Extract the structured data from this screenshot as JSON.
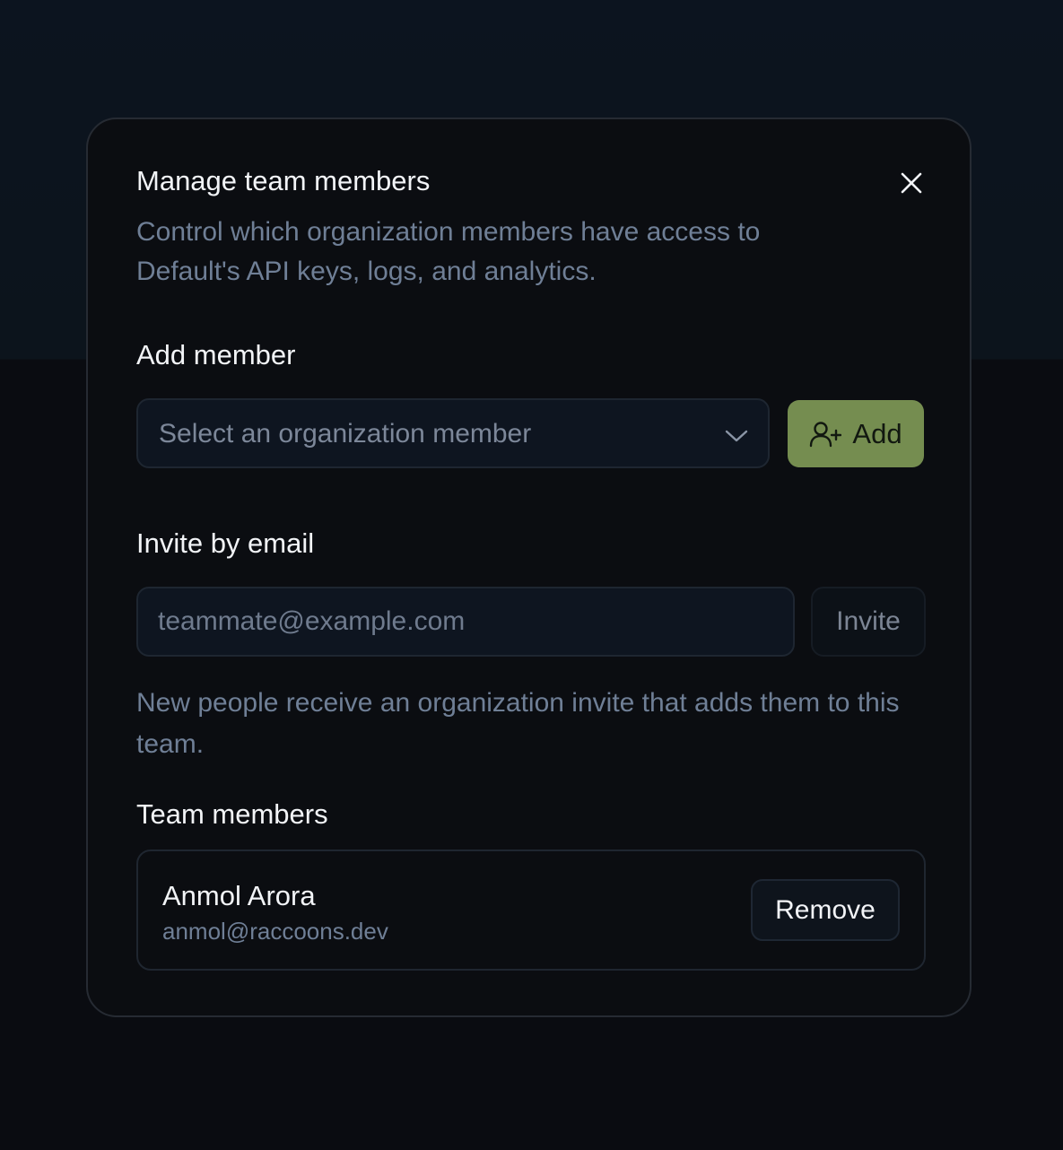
{
  "modal": {
    "title": "Manage team members",
    "description": "Control which organization members have access to Default's API keys, logs, and analytics.",
    "close_icon": "close-icon"
  },
  "add_member": {
    "label": "Add member",
    "select_placeholder": "Select an organization member",
    "chevron_icon": "chevron-down-icon",
    "add_button_label": "Add",
    "add_button_icon": "user-plus-icon",
    "add_button_color": "#758d50"
  },
  "invite": {
    "label": "Invite by email",
    "email_placeholder": "teammate@example.com",
    "invite_button_label": "Invite",
    "hint": "New people receive an organization invite that adds them to this team."
  },
  "team_members": {
    "label": "Team members",
    "members": [
      {
        "name": "Anmol Arora",
        "email": "anmol@raccoons.dev",
        "remove_label": "Remove"
      }
    ]
  }
}
